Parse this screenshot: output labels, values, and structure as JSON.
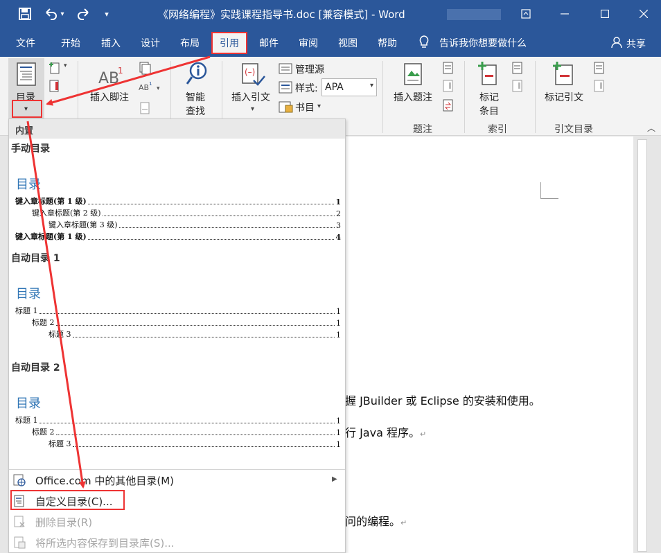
{
  "window": {
    "title": "《网络编程》实践课程指导书.doc [兼容模式] - Word",
    "icons": [
      "save-icon",
      "undo-icon",
      "redo-icon",
      "customize-qat-icon",
      "ribbon-display-icon",
      "minimize-icon",
      "maximize-icon",
      "close-icon"
    ]
  },
  "tabs": {
    "file": "文件",
    "home": "开始",
    "insert": "插入",
    "design": "设计",
    "layout": "布局",
    "references": "引用",
    "mailings": "邮件",
    "review": "审阅",
    "view": "视图",
    "help": "帮助",
    "tell_me": "告诉我你想要做什么",
    "share": "共享"
  },
  "ribbon": {
    "toc_label": "目录",
    "insert_footnote": "插入脚注",
    "smart_lookup_1": "智能",
    "smart_lookup_2": "查找",
    "insert_citation": "插入引文",
    "manage_sources": "管理源",
    "style_label": "样式:",
    "style_value": "APA",
    "bibliography": "书目",
    "insert_caption": "插入题注",
    "mark_entry_1": "标记",
    "mark_entry_2": "条目",
    "mark_citation": "标记引文",
    "group_captions": "题注",
    "group_index": "索引",
    "group_toa": "引文目录"
  },
  "dropdown": {
    "header": "内置",
    "manual_title": "手动目录",
    "manual_heading": "目录",
    "manual_lines": [
      {
        "label": "键入章标题(第 1 级)",
        "page": "1"
      },
      {
        "label": "键入章标题(第 2 级)",
        "page": "2"
      },
      {
        "label": "键入章标题(第 3 级)",
        "page": "3"
      },
      {
        "label": "键入章标题(第 1 级)",
        "page": "4"
      }
    ],
    "auto1_title": "自动目录 1",
    "auto1_heading": "目录",
    "auto1_lines": [
      {
        "label": "标题 1",
        "page": "1"
      },
      {
        "label": "标题 2",
        "page": "1"
      },
      {
        "label": "标题 3",
        "page": "1"
      }
    ],
    "auto2_title": "自动目录 2",
    "auto2_heading": "目录",
    "auto2_lines": [
      {
        "label": "标题 1",
        "page": "1"
      },
      {
        "label": "标题 2",
        "page": "1"
      },
      {
        "label": "标题 3",
        "page": "1"
      }
    ],
    "more_office": "Office.com 中的其他目录(M)",
    "custom_toc": "自定义目录(C)...",
    "remove_toc": "删除目录(R)",
    "save_selection": "将所选内容保存到目录库(S)..."
  },
  "document": {
    "line1": "握 JBuilder 或 Eclipse 的安装和使用。",
    "line2": "行 Java 程序。",
    "line3": "问的编程。"
  },
  "colors": {
    "brand": "#2b579a",
    "highlight": "#e33333",
    "toc_heading": "#2e74b5"
  }
}
